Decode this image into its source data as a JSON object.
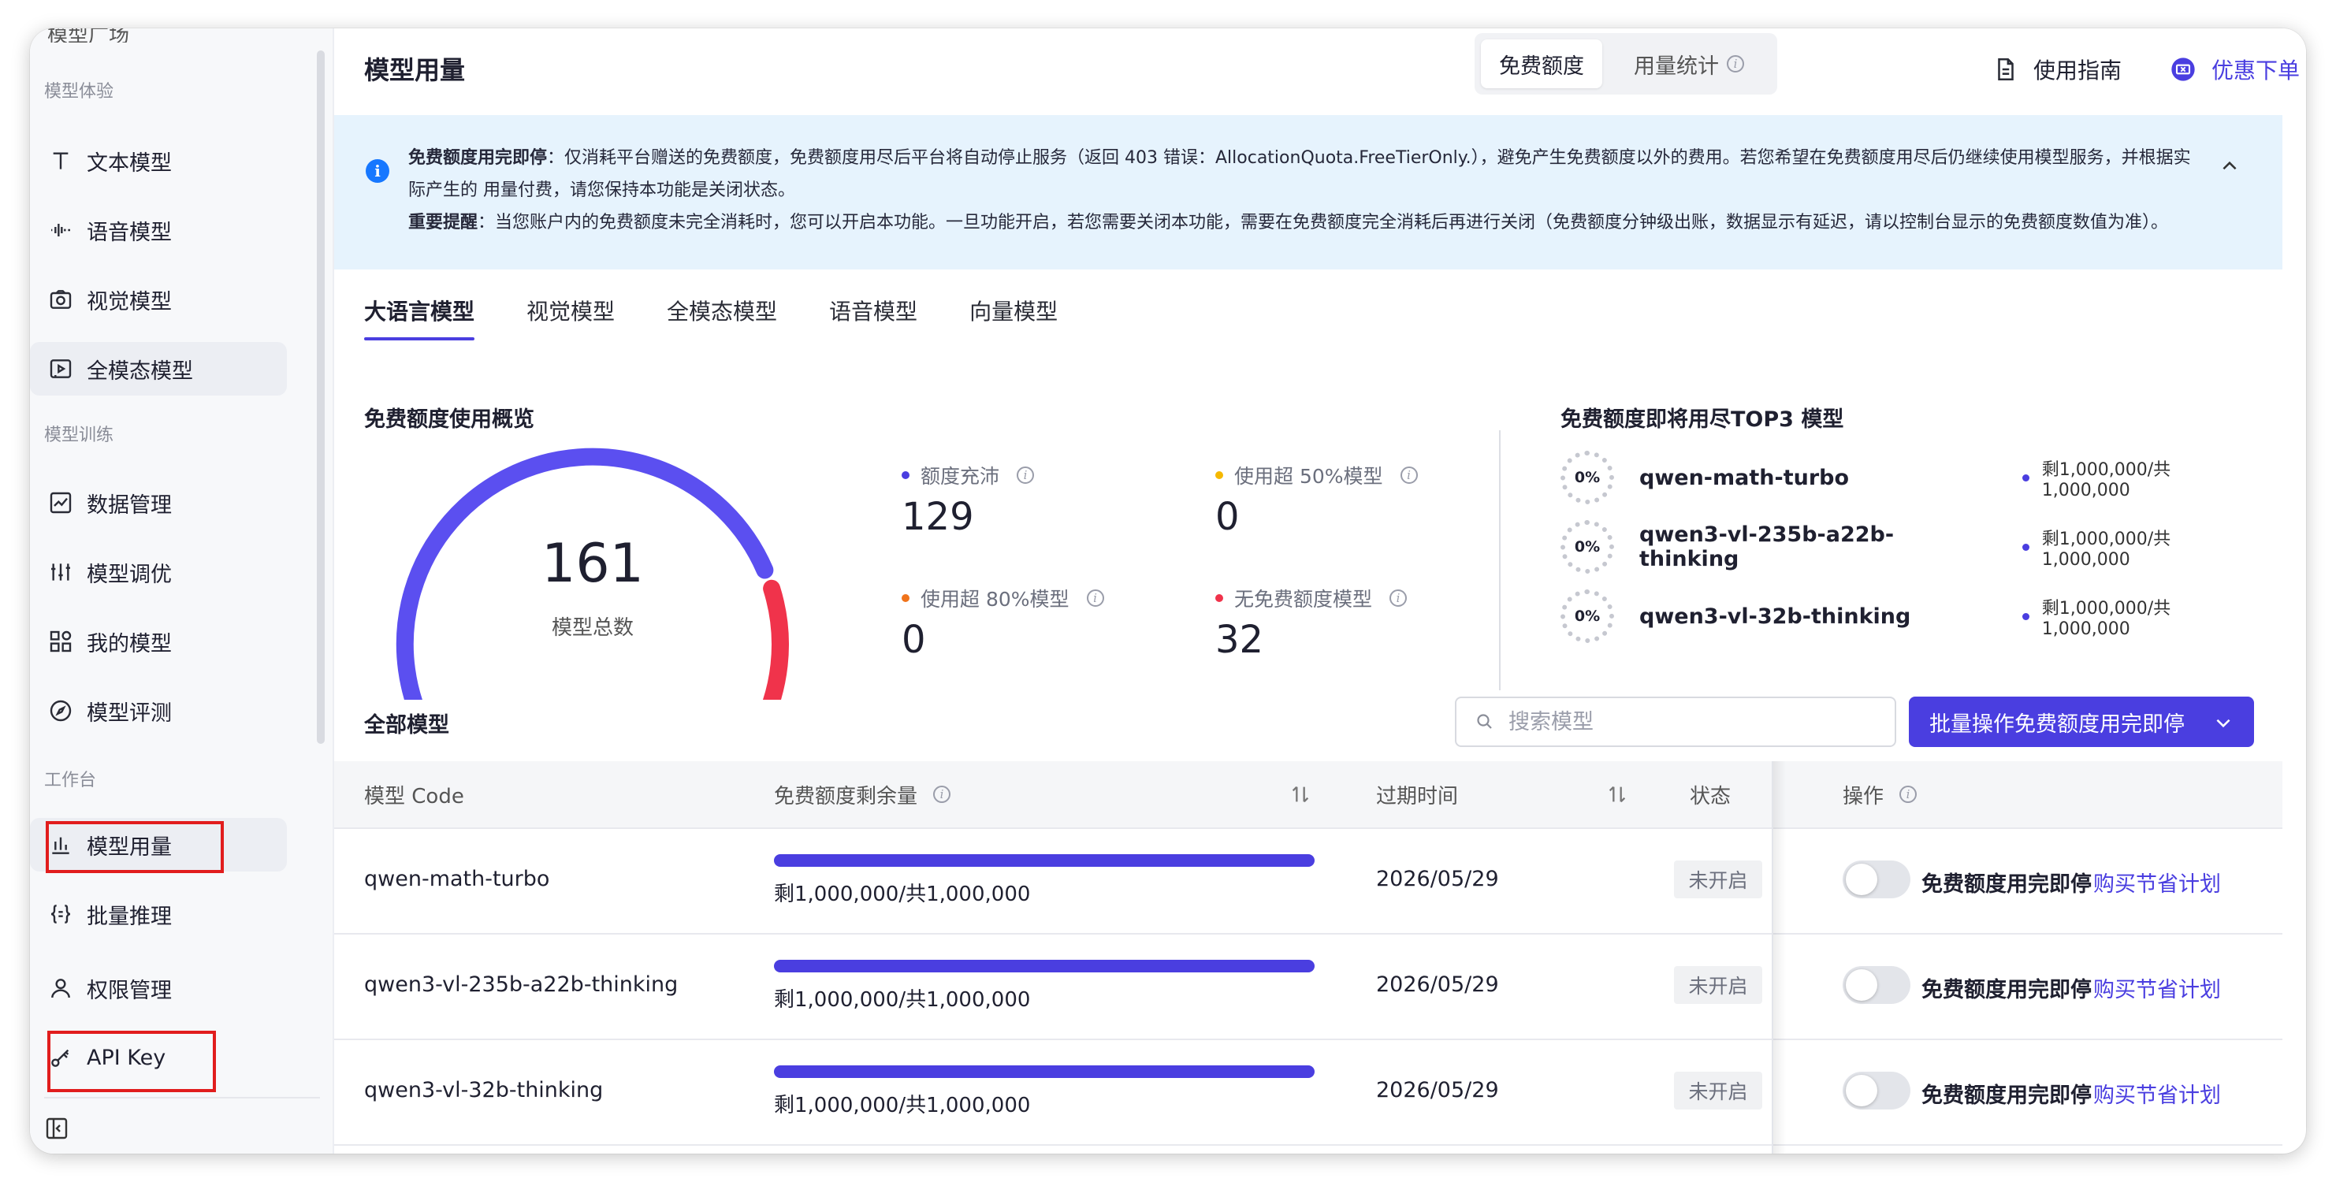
{
  "sidebar": {
    "cut_item": "模型广场",
    "groups": {
      "experience": "模型体验",
      "training": "模型训练",
      "workbench": "工作台"
    },
    "items": [
      {
        "label": "文本模型",
        "icon": "text-icon"
      },
      {
        "label": "语音模型",
        "icon": "audio-wave-icon"
      },
      {
        "label": "视觉模型",
        "icon": "camera-icon"
      },
      {
        "label": "全模态模型",
        "icon": "video-icon"
      },
      {
        "label": "数据管理",
        "icon": "chart-line-icon"
      },
      {
        "label": "模型调优",
        "icon": "sliders-icon"
      },
      {
        "label": "我的模型",
        "icon": "grid-icon"
      },
      {
        "label": "模型评测",
        "icon": "compass-icon"
      },
      {
        "label": "模型用量",
        "icon": "bar-chart-icon"
      },
      {
        "label": "批量推理",
        "icon": "braces-icon"
      },
      {
        "label": "权限管理",
        "icon": "user-icon"
      },
      {
        "label": "API Key",
        "icon": "key-icon"
      }
    ]
  },
  "header": {
    "title": "模型用量",
    "seg_free": "免费额度",
    "seg_stats": "用量统计",
    "guide": "使用指南",
    "order": "优惠下单"
  },
  "alert": {
    "p1_bold": "免费额度用完即停",
    "p1_text": "：仅消耗平台赠送的免费额度，免费额度用尽后平台将自动停止服务（返回 403 错误：AllocationQuota.FreeTierOnly.），避免产生免费额度以外的费用。若您希望在免费额度用尽后仍继续使用模型服务，并根据实际产生的 用量付费，请您保持本功能是关闭状态。",
    "p2_bold": "重要提醒",
    "p2_text": "：当您账户内的免费额度未完全消耗时，您可以开启本功能。一旦功能开启，若您需要关闭本功能，需要在免费额度完全消耗后再进行关闭（免费额度分钟级出账，数据显示有延迟，请以控制台显示的免费额度数值为准）。"
  },
  "tabs": [
    "大语言模型",
    "视觉模型",
    "全模态模型",
    "语音模型",
    "向量模型"
  ],
  "overview": {
    "title": "免费额度使用概览",
    "total": "161",
    "total_label": "模型总数",
    "gauge_fraction_blue": 0.79,
    "stats": [
      {
        "label": "额度充沛",
        "value": "129",
        "color": "#4a3ee0"
      },
      {
        "label": "使用超 50%模型",
        "value": "0",
        "color": "#f5b800"
      },
      {
        "label": "使用超 80%模型",
        "value": "0",
        "color": "#f0731b"
      },
      {
        "label": "无免费额度模型",
        "value": "32",
        "color": "#f0334b"
      }
    ]
  },
  "top3": {
    "title": "免费额度即将用尽TOP3 模型",
    "rows": [
      {
        "pct": "0%",
        "name": "qwen-math-turbo",
        "remain": "剩1,000,000/共1,000,000"
      },
      {
        "pct": "0%",
        "name": "qwen3-vl-235b-a22b-thinking",
        "remain": "剩1,000,000/共1,000,000"
      },
      {
        "pct": "0%",
        "name": "qwen3-vl-32b-thinking",
        "remain": "剩1,000,000/共1,000,000"
      }
    ]
  },
  "table": {
    "title": "全部模型",
    "search_placeholder": "搜索模型",
    "batch_button": "批量操作免费额度用完即停",
    "headers": {
      "code": "模型 Code",
      "remain": "免费额度剩余量",
      "expire": "过期时间",
      "status": "状态",
      "ops": "操作"
    },
    "rows": [
      {
        "code": "qwen-math-turbo",
        "remain": "剩1,000,000/共1,000,000",
        "remain_fraction": 1.0,
        "expire": "2026/05/29",
        "status": "未开启",
        "toggle": "免费额度用完即停",
        "buy": "购买节省计划"
      },
      {
        "code": "qwen3-vl-235b-a22b-thinking",
        "remain": "剩1,000,000/共1,000,000",
        "remain_fraction": 1.0,
        "expire": "2026/05/29",
        "status": "未开启",
        "toggle": "免费额度用完即停",
        "buy": "购买节省计划"
      },
      {
        "code": "qwen3-vl-32b-thinking",
        "remain": "剩1,000,000/共1,000,000",
        "remain_fraction": 1.0,
        "expire": "2026/05/29",
        "status": "未开启",
        "toggle": "免费额度用完即停",
        "buy": "购买节省计划"
      }
    ]
  },
  "colors": {
    "accent": "#4a3ee0",
    "gauge_blue": "#5b4ff0",
    "gauge_red": "#f0334b",
    "alert_bg": "#e6f3fd",
    "info_blue": "#1677ff"
  }
}
